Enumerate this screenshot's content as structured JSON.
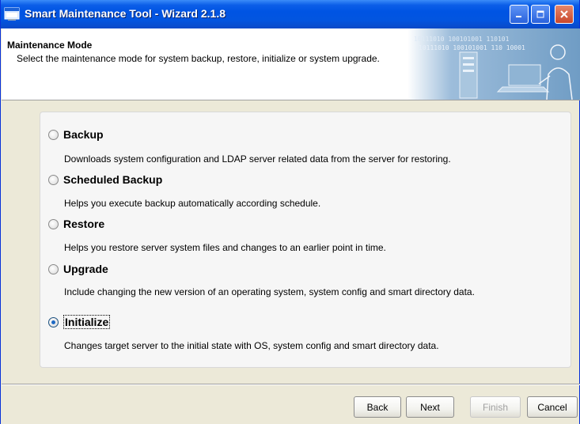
{
  "window": {
    "title": "Smart Maintenance Tool - Wizard 2.1.8"
  },
  "header": {
    "title": "Maintenance Mode",
    "description": "Select the maintenance mode for system backup, restore, initialize or system upgrade.",
    "banner_digits_line1": "10111010 100101001 110101",
    "banner_digits_line2": "10111010 100101001 110 10001"
  },
  "options": [
    {
      "label": "Backup",
      "description": "Downloads system configuration and LDAP server related data from the server for restoring.",
      "selected": false
    },
    {
      "label": "Scheduled Backup",
      "description": "Helps  you execute backup automatically according schedule.",
      "selected": false
    },
    {
      "label": "Restore",
      "description": "Helps you restore server system files and changes to an earlier point in time.",
      "selected": false
    },
    {
      "label": "Upgrade",
      "description": "Include changing the new version of an operating system, system config and smart directory data.",
      "selected": false
    },
    {
      "label": "Initialize",
      "description": "Changes target server to the initial state with OS, system config and smart directory data.",
      "selected": true
    }
  ],
  "buttons": {
    "back": "Back",
    "next": "Next",
    "finish": "Finish",
    "cancel": "Cancel"
  },
  "colors": {
    "titlebar": "#0054e3",
    "banner": "#7fa7c9",
    "dialog_bg": "#ece9d8"
  }
}
